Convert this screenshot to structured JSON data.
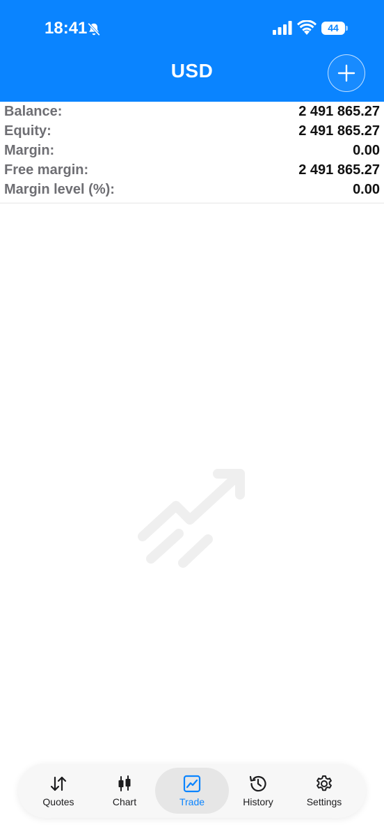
{
  "status_bar": {
    "time": "18:41",
    "battery": "44",
    "icons": [
      "bell-slash-icon",
      "signal-icon",
      "wifi-icon",
      "battery-icon"
    ]
  },
  "header": {
    "title": "USD",
    "add_icon": "plus-icon",
    "background": "#0a84ff"
  },
  "account": {
    "rows": [
      {
        "label": "Balance:",
        "value": "2 491 865.27"
      },
      {
        "label": "Equity:",
        "value": "2 491 865.27"
      },
      {
        "label": "Margin:",
        "value": "0.00"
      },
      {
        "label": "Free margin:",
        "value": "2 491 865.27"
      },
      {
        "label": "Margin level (%):",
        "value": "0.00"
      }
    ]
  },
  "empty_state": {
    "icon": "trend-arrow-icon"
  },
  "tab_bar": {
    "tabs": [
      {
        "label": "Quotes",
        "icon": "quotes-arrows-icon"
      },
      {
        "label": "Chart",
        "icon": "candlestick-icon"
      },
      {
        "label": "Trade",
        "icon": "trade-chart-icon",
        "active": true
      },
      {
        "label": "History",
        "icon": "history-clock-icon"
      },
      {
        "label": "Settings",
        "icon": "gear-icon"
      }
    ],
    "active_color": "#0a84ff"
  }
}
